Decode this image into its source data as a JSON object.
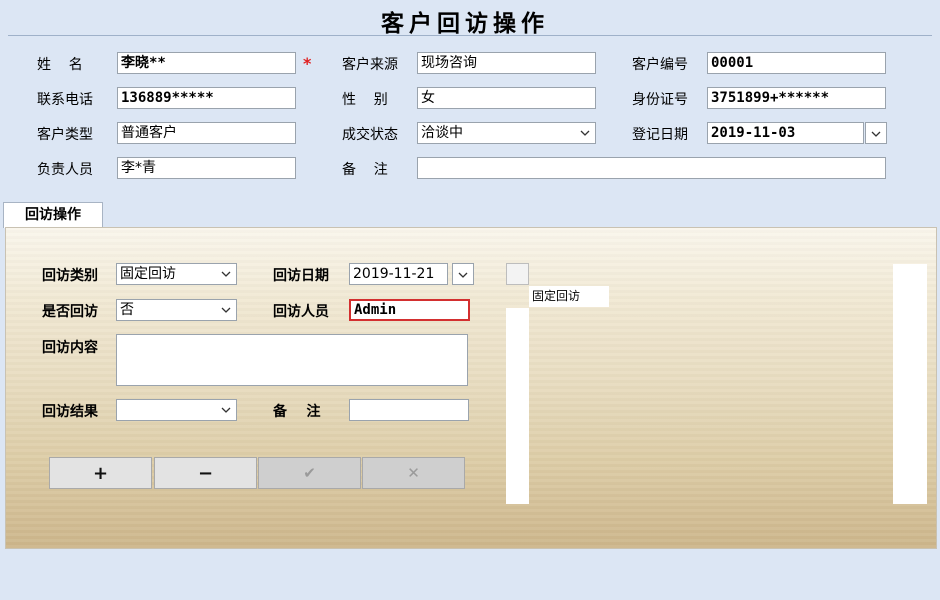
{
  "title": "客户回访操作",
  "customer": {
    "name_label": "姓    名",
    "name_value": "李晓**",
    "required_mark": "*",
    "source_label": "客户来源",
    "source_value": "现场咨询",
    "id_label": "客户编号",
    "id_value": "00001",
    "phone_label": "联系电话",
    "phone_value": "136889*****",
    "gender_label": "性    别",
    "gender_value": "女",
    "idcard_label": "身份证号",
    "idcard_value": "3751899+******",
    "type_label": "客户类型",
    "type_value": "普通客户",
    "deal_label": "成交状态",
    "deal_value": "洽谈中",
    "regdate_label": "登记日期",
    "regdate_value": "2019-11-03",
    "owner_label": "负责人员",
    "owner_value": "李*青",
    "remark_label": "备    注",
    "remark_value": ""
  },
  "tab": {
    "label": "回访操作"
  },
  "visit": {
    "category_label": "回访类别",
    "category_value": "固定回访",
    "date_label": "回访日期",
    "date_value": "2019-11-21",
    "is_visited_label": "是否回访",
    "is_visited_value": "否",
    "person_label": "回访人员",
    "person_value": "Admin",
    "content_label": "回访内容",
    "content_value": "",
    "result_label": "回访结果",
    "result_value": "",
    "remark_label": "备    注",
    "remark_value": ""
  },
  "buttons": {
    "add": "+",
    "remove": "−",
    "confirm": "✔",
    "cancel": "✕"
  },
  "list": {
    "items": [
      "固定回访"
    ]
  },
  "colors": {
    "background": "#dce6f4",
    "required": "#e02020",
    "error_border": "#d32f2f"
  }
}
